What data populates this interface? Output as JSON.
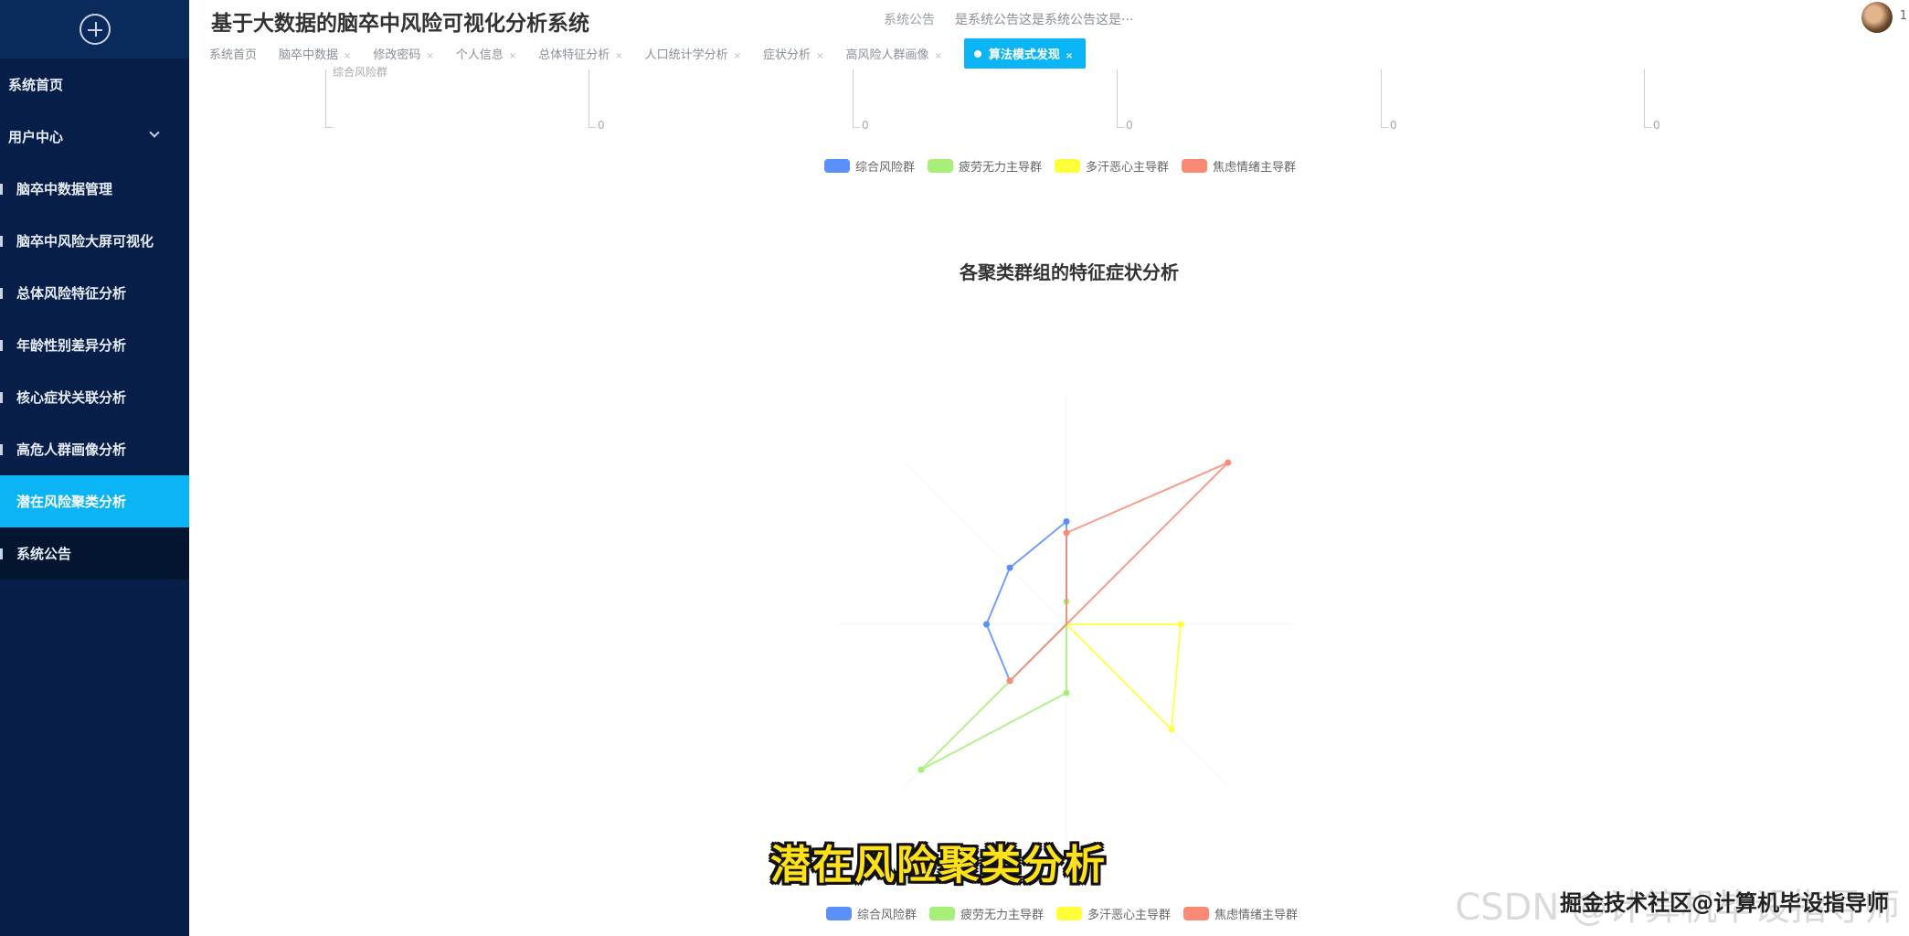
{
  "app": {
    "title": "基于大数据的脑卒中风险可视化分析系统"
  },
  "header": {
    "notice_label": "系统公告",
    "notice_text": "是系统公告这是系统公告这是···",
    "user_text": "1"
  },
  "sidebar": {
    "items": [
      {
        "label": "系统首页"
      },
      {
        "label": "用户中心"
      },
      {
        "label": "脑卒中数据管理"
      },
      {
        "label": "脑卒中风险大屏可视化"
      },
      {
        "label": "总体风险特征分析"
      },
      {
        "label": "年龄性别差异分析"
      },
      {
        "label": "核心症状关联分析"
      },
      {
        "label": "高危人群画像分析"
      },
      {
        "label": "潜在风险聚类分析"
      },
      {
        "label": "系统公告"
      }
    ]
  },
  "tabs": [
    {
      "label": "系统首页"
    },
    {
      "label": "脑卒中数据"
    },
    {
      "label": "修改密码"
    },
    {
      "label": "个人信息"
    },
    {
      "label": "总体特征分析"
    },
    {
      "label": "人口统计学分析"
    },
    {
      "label": "症状分析"
    },
    {
      "label": "高风险人群画像"
    },
    {
      "label": "算法模式发现"
    }
  ],
  "fragment": {
    "label": "综合风险群",
    "zeros": [
      "0",
      "0",
      "0",
      "0",
      "0"
    ]
  },
  "legend_items": [
    {
      "name": "综合风险群",
      "color": "#5b8ff9"
    },
    {
      "name": "疲劳无力主导群",
      "color": "#a6f07a"
    },
    {
      "name": "多汗恶心主导群",
      "color": "#ffff3a"
    },
    {
      "name": "焦虑情绪主导群",
      "color": "#fa8a74"
    }
  ],
  "chart_data": {
    "type": "radar",
    "title": "各聚类群组的特征症状分析",
    "series": [
      {
        "name": "综合风险群",
        "color": "#5b8ff9",
        "values": [
          0.45,
          0.0,
          0.0,
          0.0,
          0.0,
          0.35,
          0.35,
          0.35
        ]
      },
      {
        "name": "疲劳无力主导群",
        "color": "#a6f07a",
        "values": [
          0.1,
          0.0,
          0.0,
          0.0,
          0.3,
          0.9,
          0.0,
          0.0
        ]
      },
      {
        "name": "多汗恶心主导群",
        "color": "#ffff3a",
        "values": [
          0.0,
          0.0,
          0.5,
          0.65,
          0.0,
          0.0,
          0.0,
          0.0
        ]
      },
      {
        "name": "焦虑情绪主导群",
        "color": "#fa8a74",
        "values": [
          0.4,
          1.0,
          0.0,
          0.0,
          0.0,
          0.35,
          0.0,
          0.0
        ]
      }
    ]
  },
  "overlay": {
    "subtitle": "潜在风险聚类分析",
    "watermark": "掘金技术社区@计算机毕设指导师",
    "watermark_bg": "CSDN @计算机毕设指导师"
  }
}
